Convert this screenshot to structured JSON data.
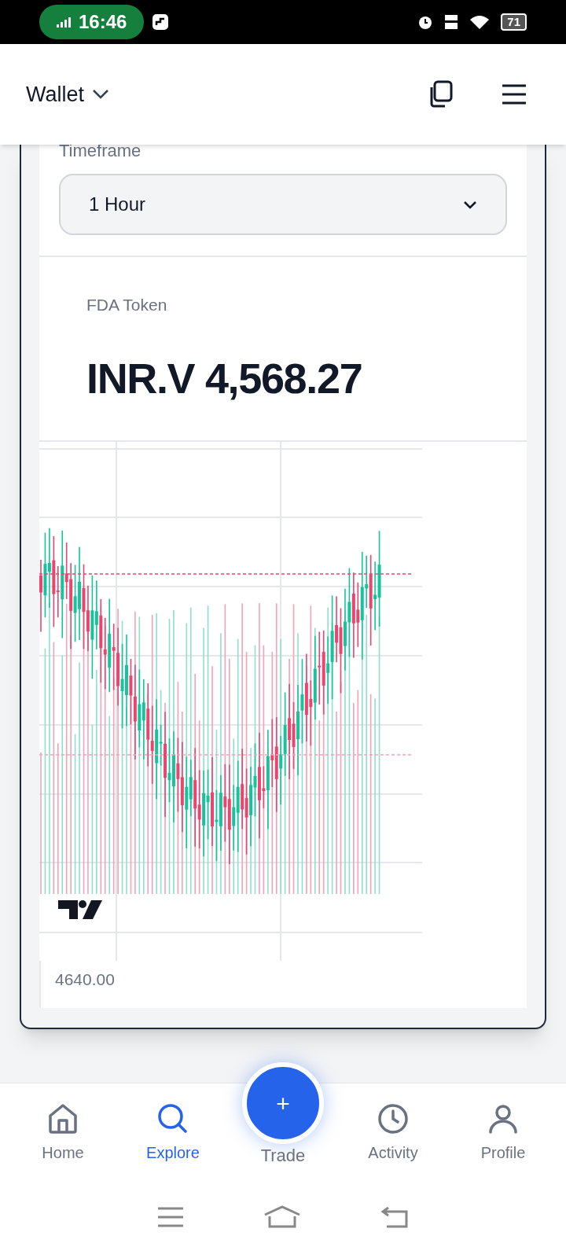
{
  "status_bar": {
    "time": "16:46",
    "battery": "71"
  },
  "header": {
    "title": "Wallet"
  },
  "timeframe": {
    "label": "Timeframe",
    "value": "1 Hour"
  },
  "token": {
    "name": "FDA Token",
    "price": "INR.V 4,568.27"
  },
  "chart": {
    "axis_label": "4640.00"
  },
  "nav": [
    {
      "label": "Home",
      "selected": false,
      "kind": "tab"
    },
    {
      "label": "Explore",
      "selected": true,
      "kind": "tab"
    },
    {
      "label": "Trade",
      "selected": false,
      "kind": "fab",
      "symbol": "+"
    },
    {
      "label": "Activity",
      "selected": false,
      "kind": "tab"
    },
    {
      "label": "Profile",
      "selected": false,
      "kind": "tab"
    }
  ]
}
